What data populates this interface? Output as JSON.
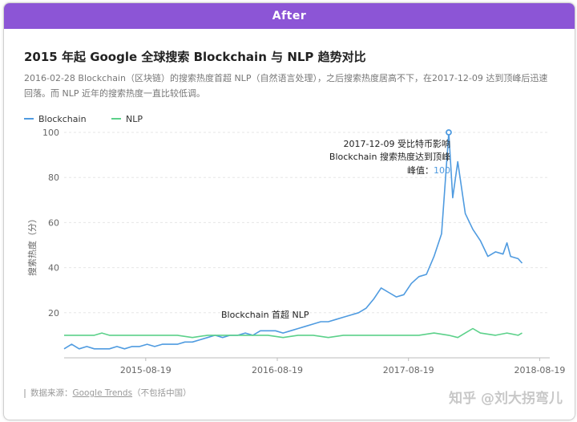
{
  "banner": {
    "label": "After"
  },
  "header": {
    "title": "2015 年起 Google 全球搜索 Blockchain 与 NLP 趋势对比",
    "subtitle": "2016-02-28 Blockchain（区块链）的搜索热度首超 NLP（自然语言处理），之后搜索热度居高不下，在2017-12-09 达到顶峰后迅速回落。而 NLP 近年的搜索热度一直比较低调。"
  },
  "colors": {
    "blockchain": "#4f9be0",
    "nlp": "#5cd18a",
    "grid": "#e6e6e6",
    "banner": "#8c55d6"
  },
  "footer": {
    "source_prefix": "数据来源：",
    "source_link": "Google Trends",
    "source_suffix": "（不包括中国）",
    "watermark": "知乎 @刘大拐弯儿"
  },
  "chart_data": {
    "type": "line",
    "ylabel": "搜索热度（分）",
    "ylim": [
      0,
      100
    ],
    "yticks": [
      20,
      40,
      60,
      80,
      100
    ],
    "xlim": [
      "2015-01-04",
      "2018-09-16"
    ],
    "xticks": [
      "2015-08-19",
      "2016-08-19",
      "2017-08-19",
      "2018-08-19"
    ],
    "legend": "top-left",
    "grid": true,
    "series": [
      {
        "name": "Blockchain",
        "color": "#4f9be0",
        "points": [
          [
            "2015-01-04",
            4
          ],
          [
            "2015-01-25",
            6
          ],
          [
            "2015-02-15",
            4
          ],
          [
            "2015-03-08",
            5
          ],
          [
            "2015-03-29",
            4
          ],
          [
            "2015-04-19",
            4
          ],
          [
            "2015-05-10",
            4
          ],
          [
            "2015-05-31",
            5
          ],
          [
            "2015-06-21",
            4
          ],
          [
            "2015-07-12",
            5
          ],
          [
            "2015-08-02",
            5
          ],
          [
            "2015-08-23",
            6
          ],
          [
            "2015-09-13",
            5
          ],
          [
            "2015-10-04",
            6
          ],
          [
            "2015-10-25",
            6
          ],
          [
            "2015-11-15",
            6
          ],
          [
            "2015-12-06",
            7
          ],
          [
            "2015-12-27",
            7
          ],
          [
            "2016-01-17",
            8
          ],
          [
            "2016-02-07",
            9
          ],
          [
            "2016-02-28",
            10
          ],
          [
            "2016-03-20",
            9
          ],
          [
            "2016-04-10",
            10
          ],
          [
            "2016-05-01",
            10
          ],
          [
            "2016-05-22",
            11
          ],
          [
            "2016-06-12",
            10
          ],
          [
            "2016-07-03",
            12
          ],
          [
            "2016-07-24",
            12
          ],
          [
            "2016-08-14",
            12
          ],
          [
            "2016-09-04",
            11
          ],
          [
            "2016-09-25",
            12
          ],
          [
            "2016-10-16",
            13
          ],
          [
            "2016-11-06",
            14
          ],
          [
            "2016-11-27",
            15
          ],
          [
            "2016-12-18",
            16
          ],
          [
            "2017-01-08",
            16
          ],
          [
            "2017-01-29",
            17
          ],
          [
            "2017-02-19",
            18
          ],
          [
            "2017-03-12",
            19
          ],
          [
            "2017-04-02",
            20
          ],
          [
            "2017-04-23",
            22
          ],
          [
            "2017-05-14",
            26
          ],
          [
            "2017-06-04",
            31
          ],
          [
            "2017-06-25",
            29
          ],
          [
            "2017-07-16",
            27
          ],
          [
            "2017-08-06",
            28
          ],
          [
            "2017-08-27",
            33
          ],
          [
            "2017-09-17",
            36
          ],
          [
            "2017-10-08",
            37
          ],
          [
            "2017-10-29",
            45
          ],
          [
            "2017-11-19",
            55
          ],
          [
            "2017-12-09",
            100
          ],
          [
            "2017-12-20",
            71
          ],
          [
            "2018-01-03",
            87
          ],
          [
            "2018-01-24",
            64
          ],
          [
            "2018-02-14",
            57
          ],
          [
            "2018-03-07",
            52
          ],
          [
            "2018-03-28",
            45
          ],
          [
            "2018-04-18",
            47
          ],
          [
            "2018-05-09",
            46
          ],
          [
            "2018-05-20",
            51
          ],
          [
            "2018-05-30",
            45
          ],
          [
            "2018-06-20",
            44
          ],
          [
            "2018-07-01",
            42
          ]
        ]
      },
      {
        "name": "NLP",
        "color": "#5cd18a",
        "points": [
          [
            "2015-01-04",
            10
          ],
          [
            "2015-02-15",
            10
          ],
          [
            "2015-03-29",
            10
          ],
          [
            "2015-04-19",
            11
          ],
          [
            "2015-05-10",
            10
          ],
          [
            "2015-05-31",
            10
          ],
          [
            "2015-07-12",
            10
          ],
          [
            "2015-08-23",
            10
          ],
          [
            "2015-10-04",
            10
          ],
          [
            "2015-11-15",
            10
          ],
          [
            "2015-12-27",
            9
          ],
          [
            "2016-02-07",
            10
          ],
          [
            "2016-03-20",
            10
          ],
          [
            "2016-05-01",
            10
          ],
          [
            "2016-06-12",
            10
          ],
          [
            "2016-07-24",
            10
          ],
          [
            "2016-09-04",
            9
          ],
          [
            "2016-10-16",
            10
          ],
          [
            "2016-11-27",
            10
          ],
          [
            "2017-01-08",
            9
          ],
          [
            "2017-02-19",
            10
          ],
          [
            "2017-04-02",
            10
          ],
          [
            "2017-05-14",
            10
          ],
          [
            "2017-06-25",
            10
          ],
          [
            "2017-08-06",
            10
          ],
          [
            "2017-09-17",
            10
          ],
          [
            "2017-10-29",
            11
          ],
          [
            "2017-12-09",
            10
          ],
          [
            "2018-01-03",
            9
          ],
          [
            "2018-01-24",
            11
          ],
          [
            "2018-02-14",
            13
          ],
          [
            "2018-03-07",
            11
          ],
          [
            "2018-04-18",
            10
          ],
          [
            "2018-05-20",
            11
          ],
          [
            "2018-06-20",
            10
          ],
          [
            "2018-07-01",
            11
          ]
        ]
      }
    ],
    "annotations": [
      {
        "date": "2016-02-28",
        "value": 10,
        "text": "Blockchain 首超 NLP"
      },
      {
        "date": "2017-12-09",
        "value": 100,
        "lines": [
          "2017-12-09 受比特币影响",
          "Blockchain 搜索热度达到顶峰"
        ],
        "peak_prefix": "峰值：",
        "peak_value": "100"
      }
    ]
  }
}
